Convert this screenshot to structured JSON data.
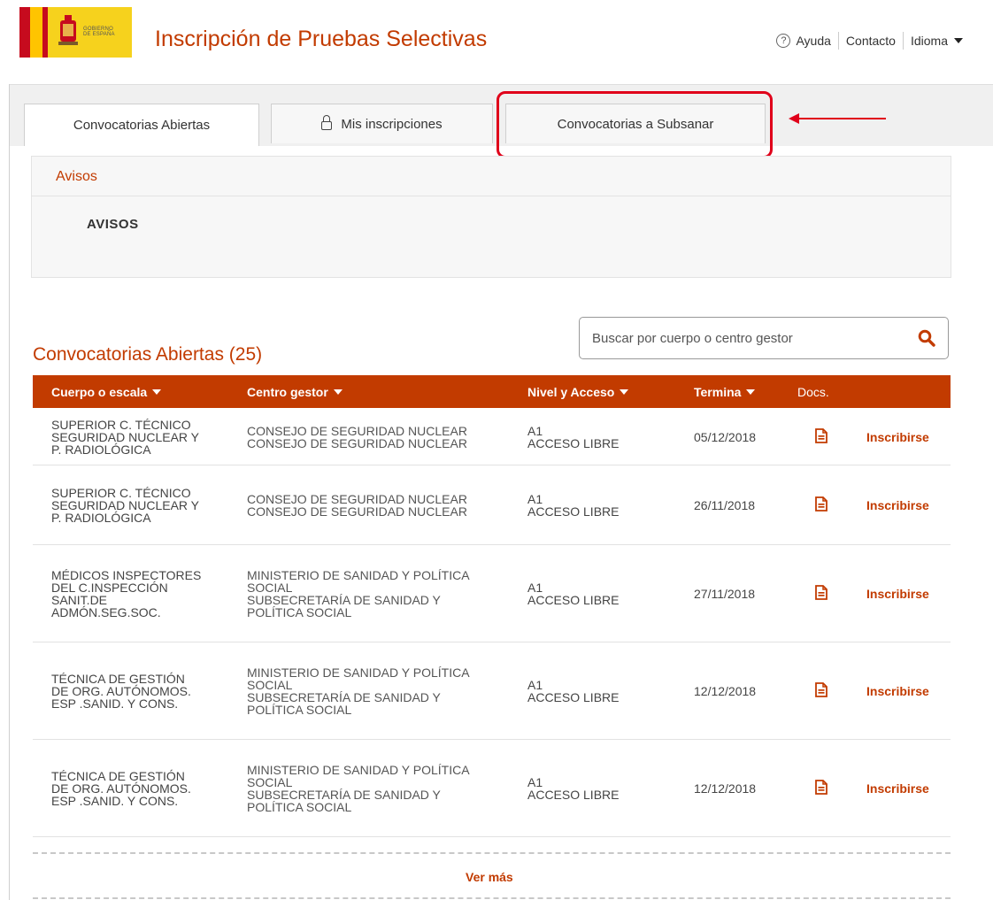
{
  "header": {
    "logo_text": "GOBIERNO DE ESPAÑA",
    "title": "Inscripción de Pruebas Selectivas",
    "links": {
      "help": "Ayuda",
      "contact": "Contacto",
      "language": "Idioma"
    }
  },
  "tabs": [
    {
      "label": "Convocatorias Abiertas",
      "active": true
    },
    {
      "label": "Mis inscripciones",
      "icon": "lock-icon"
    },
    {
      "label": "Convocatorias a Subsanar",
      "highlighted": true
    }
  ],
  "avisos": {
    "title": "Avisos",
    "subtitle": "AVISOS"
  },
  "section": {
    "title": "Convocatorias Abiertas (25)"
  },
  "search": {
    "placeholder": "Buscar por cuerpo o centro gestor",
    "value": ""
  },
  "table": {
    "headers": {
      "cuerpo": "Cuerpo o escala",
      "centro": "Centro gestor",
      "nivel": "Nivel y Acceso",
      "termina": "Termina",
      "docs": "Docs."
    },
    "action_label": "Inscribirse",
    "rows": [
      {
        "cuerpo": [
          "SUPERIOR C. TÉCNICO",
          "SEGURIDAD NUCLEAR Y",
          "P. RADIOLÓGICA"
        ],
        "centro": [
          "CONSEJO DE SEGURIDAD NUCLEAR",
          "CONSEJO DE SEGURIDAD NUCLEAR"
        ],
        "nivel": [
          "A1",
          "ACCESO LIBRE"
        ],
        "termina": "05/12/2018"
      },
      {
        "cuerpo": [
          "SUPERIOR C. TÉCNICO",
          "SEGURIDAD NUCLEAR Y",
          "P. RADIOLÓGICA"
        ],
        "centro": [
          "CONSEJO DE SEGURIDAD NUCLEAR",
          "CONSEJO DE SEGURIDAD NUCLEAR"
        ],
        "nivel": [
          "A1",
          "ACCESO LIBRE"
        ],
        "termina": "26/11/2018"
      },
      {
        "cuerpo": [
          "MÉDICOS INSPECTORES",
          "DEL C.INSPECCIÓN",
          "SANIT.DE",
          "ADMÓN.SEG.SOC."
        ],
        "centro": [
          "MINISTERIO DE SANIDAD Y POLÍTICA",
          "SOCIAL",
          "SUBSECRETARÍA DE SANIDAD Y",
          "POLÍTICA SOCIAL"
        ],
        "nivel": [
          "A1",
          "ACCESO LIBRE"
        ],
        "termina": "27/11/2018"
      },
      {
        "cuerpo": [
          "TÉCNICA DE GESTIÓN",
          "DE ORG. AUTÓNOMOS.",
          "ESP .SANID. Y CONS."
        ],
        "centro": [
          "MINISTERIO DE SANIDAD Y POLÍTICA",
          "SOCIAL",
          "SUBSECRETARÍA DE SANIDAD Y",
          "POLÍTICA SOCIAL"
        ],
        "nivel": [
          "A1",
          "ACCESO LIBRE"
        ],
        "termina": "12/12/2018"
      },
      {
        "cuerpo": [
          "TÉCNICA DE GESTIÓN",
          "DE ORG. AUTÓNOMOS.",
          "ESP .SANID. Y CONS."
        ],
        "centro": [
          "MINISTERIO DE SANIDAD Y POLÍTICA",
          "SOCIAL",
          "SUBSECRETARÍA DE SANIDAD Y",
          "POLÍTICA SOCIAL"
        ],
        "nivel": [
          "A1",
          "ACCESO LIBRE"
        ],
        "termina": "12/12/2018"
      }
    ]
  },
  "more_label": "Ver más",
  "colors": {
    "brand": "#c23b00",
    "highlight": "#e0001a"
  }
}
